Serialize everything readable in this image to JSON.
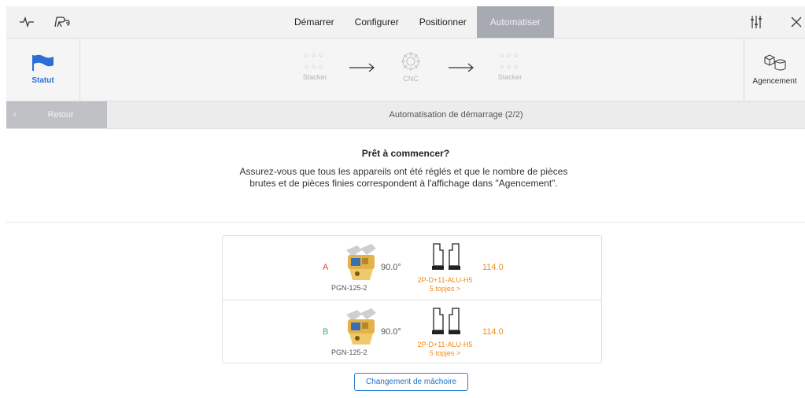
{
  "topbar": {
    "tabs": [
      {
        "label": "Démarrer",
        "active": false
      },
      {
        "label": "Configurer",
        "active": false
      },
      {
        "label": "Positionner",
        "active": false
      },
      {
        "label": "Automatiser",
        "active": true
      }
    ],
    "icons": [
      "pulse-icon",
      "robot-logo-icon",
      "sliders-icon",
      "close-icon"
    ]
  },
  "workflow": {
    "status_label": "Statut",
    "layout_label": "Agencement",
    "nodes": [
      {
        "label": "Stacker"
      },
      {
        "label": "CNC"
      },
      {
        "label": "Stacker"
      }
    ]
  },
  "backbar": {
    "back_label": "Retour",
    "title": "Automatisation de démarrage (2/2)"
  },
  "intro": {
    "title": "Prêt à commencer?",
    "text": "Assurez-vous que tous les appareils ont été réglés et que le nombre de pièces brutes et de pièces finies correspondent à l'affichage dans \"Agencement\"."
  },
  "grippers": [
    {
      "letter": "A",
      "letter_color": "#e8442f",
      "angle": "90.0°",
      "model": "PGN-125-2",
      "jaw": "2P-D+11-ALU-H5",
      "jaw_count": "5 topjes >",
      "height": "114.0"
    },
    {
      "letter": "B",
      "letter_color": "#3cb55a",
      "angle": "90.0°",
      "model": "PGN-125-2",
      "jaw": "2P-D+11-ALU-H5",
      "jaw_count": "5 topjes >",
      "height": "114.0"
    }
  ],
  "change_button": "Changement de mâchoire",
  "colors": {
    "accent": "#2a7fd4",
    "orange": "#f08a1a",
    "active_tab": "#a7aab3"
  }
}
